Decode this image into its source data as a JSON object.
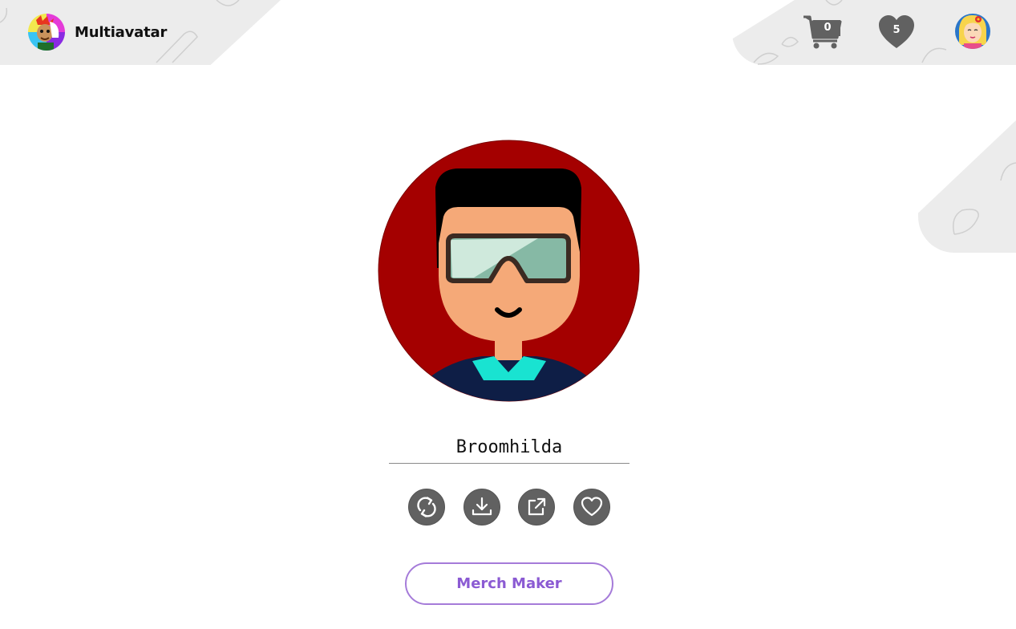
{
  "brand": {
    "name": "Multiavatar",
    "logo_icon": "multiavatar-logo-icon"
  },
  "header": {
    "cart_icon": "cart-icon",
    "cart_count": "0",
    "favorites_icon": "heart-icon",
    "favorites_count": "5",
    "user_avatar_icon": "user-avatar-icon"
  },
  "avatar": {
    "name": "Broomhilda",
    "colors": {
      "background": "#a40000",
      "skin": "#f5a978",
      "hair": "#000000",
      "goggles": "#cfe9dc",
      "shirt": "#0e1e46",
      "collar": "#19e3d1"
    }
  },
  "actions": [
    {
      "icon": "refresh-icon"
    },
    {
      "icon": "download-icon"
    },
    {
      "icon": "share-icon"
    },
    {
      "icon": "heart-outline-icon"
    }
  ],
  "merch_button": {
    "label": "Merch Maker"
  },
  "colors": {
    "accent": "#8b5bd3",
    "header_bg": "#ececec",
    "icon_gray": "#616161"
  }
}
